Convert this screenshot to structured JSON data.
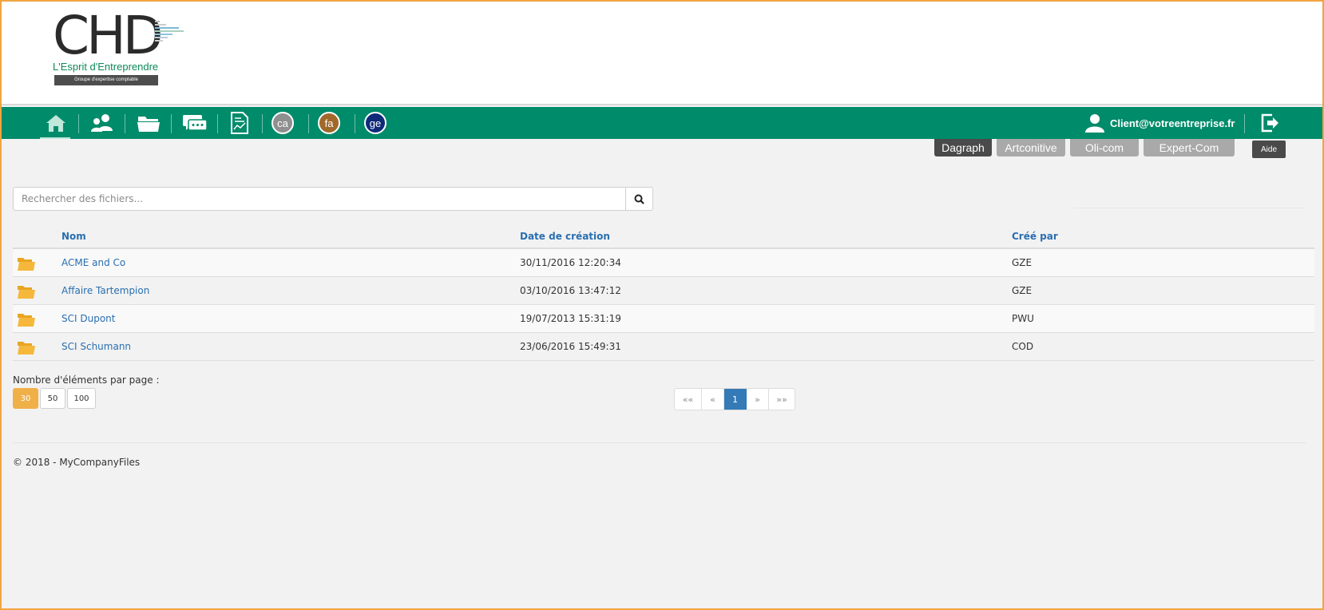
{
  "logo": {
    "brand": "CHD",
    "tagline": "L'Esprit d'Entreprendre",
    "subline": "Groupe d'expertise comptable"
  },
  "nav": {
    "icons": [
      "home-icon",
      "users-icon",
      "folder-icon",
      "chat-icon",
      "report-icon"
    ],
    "circles": [
      {
        "label": "ca",
        "color": "#8f8f8f"
      },
      {
        "label": "fa",
        "color": "#a0692a"
      },
      {
        "label": "ge",
        "color": "#0f2a78"
      }
    ],
    "user_email": "Client@votreentreprise.fr",
    "bar_color": "#008b6a"
  },
  "links": {
    "dagraph": "Dagraph",
    "artconitive": "Artconitive",
    "olicom": "Oli-com",
    "expertcom": "Expert-Com",
    "aide": "Aide"
  },
  "search": {
    "placeholder": "Rechercher des fichiers..."
  },
  "table": {
    "headers": {
      "name": "Nom",
      "date": "Date de création",
      "author": "Créé par"
    },
    "rows": [
      {
        "name": "ACME and Co",
        "date": "30/11/2016 12:20:34",
        "author": "GZE"
      },
      {
        "name": "Affaire Tartempion",
        "date": "03/10/2016 13:47:12",
        "author": "GZE"
      },
      {
        "name": "SCI Dupont",
        "date": "19/07/2013 15:31:19",
        "author": "PWU"
      },
      {
        "name": "SCI Schumann",
        "date": "23/06/2016 15:49:31",
        "author": "COD"
      }
    ]
  },
  "pagesize": {
    "label": "Nombre d'éléments par page :",
    "options": [
      "30",
      "50",
      "100"
    ],
    "selected": "30"
  },
  "pagination": {
    "first": "««",
    "prev": "«",
    "current": "1",
    "next": "»",
    "last": "»»"
  },
  "footer": {
    "text": "© 2018 - MyCompanyFiles"
  }
}
